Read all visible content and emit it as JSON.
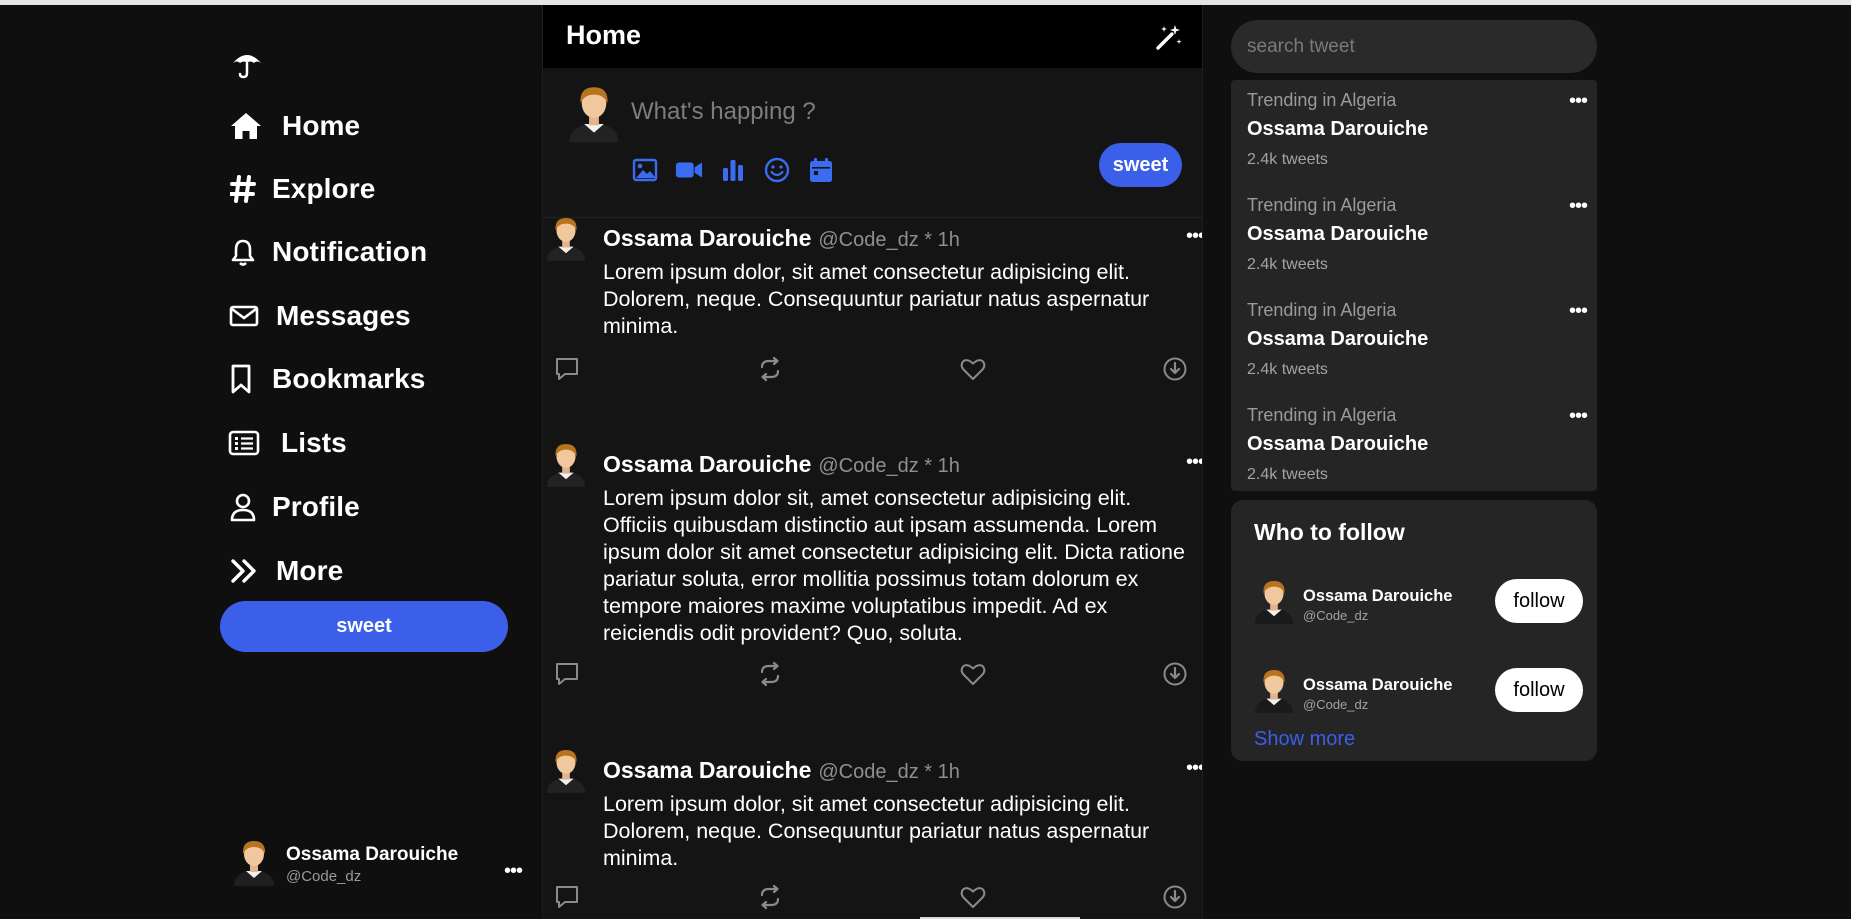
{
  "theme": {
    "accent": "#3b5fe8",
    "background": "#0f0f0f",
    "panel": "#252525",
    "feed": "#141414"
  },
  "sidebar": {
    "logo_icon": "umbrella-icon",
    "items": [
      {
        "label": "Home",
        "icon": "home-icon"
      },
      {
        "label": "Explore",
        "icon": "hash-icon"
      },
      {
        "label": "Notification",
        "icon": "bell-icon"
      },
      {
        "label": "Messages",
        "icon": "envelope-icon"
      },
      {
        "label": "Bookmarks",
        "icon": "bookmark-icon"
      },
      {
        "label": "Lists",
        "icon": "list-icon"
      },
      {
        "label": "Profile",
        "icon": "user-icon"
      },
      {
        "label": "More",
        "icon": "chevrons-right-icon"
      }
    ],
    "sweet_label": "sweet",
    "account": {
      "name": "Ossama Darouiche",
      "handle": "@Code_dz",
      "more": "•••"
    }
  },
  "feed": {
    "title": "Home",
    "header_icon": "magic-wand-icon",
    "composer": {
      "placeholder": "What's happing ?",
      "tools": [
        "image-icon",
        "video-icon",
        "poll-icon",
        "emoji-icon",
        "calendar-icon"
      ],
      "sweet_label": "sweet"
    },
    "tweets": [
      {
        "name": "Ossama Darouiche",
        "meta": "@Code_dz * 1h",
        "more": "•••",
        "text": "Lorem ipsum dolor, sit amet consectetur adipisicing elit. Dolorem, neque. Consequuntur pariatur natus aspernatur minima."
      },
      {
        "name": "Ossama Darouiche",
        "meta": "@Code_dz * 1h",
        "more": "•••",
        "text": "Lorem ipsum dolor sit, amet consectetur adipisicing elit. Officiis quibusdam distinctio aut ipsam assumenda. Lorem ipsum dolor sit amet consectetur adipisicing elit. Dicta ratione pariatur soluta, error mollitia possimus totam dolorum ex tempore maiores maxime voluptatibus impedit. Ad ex reiciendis odit provident? Quo, soluta."
      },
      {
        "name": "Ossama Darouiche",
        "meta": "@Code_dz * 1h",
        "more": "•••",
        "text": "Lorem ipsum dolor, sit amet consectetur adipisicing elit. Dolorem, neque. Consequuntur pariatur natus aspernatur minima."
      }
    ],
    "action_icons": [
      "comment-icon",
      "retweet-icon",
      "heart-icon",
      "download-icon"
    ]
  },
  "right": {
    "search_placeholder": "search tweet",
    "trends": [
      {
        "context": "Trending in Algeria",
        "title": "Ossama Darouiche",
        "count": "2.4k tweets",
        "more": "•••"
      },
      {
        "context": "Trending in Algeria",
        "title": "Ossama Darouiche",
        "count": "2.4k tweets",
        "more": "•••"
      },
      {
        "context": "Trending in Algeria",
        "title": "Ossama Darouiche",
        "count": "2.4k tweets",
        "more": "•••"
      },
      {
        "context": "Trending in Algeria",
        "title": "Ossama Darouiche",
        "count": "2.4k tweets",
        "more": "•••"
      }
    ],
    "who_to_follow": {
      "title": "Who to follow",
      "users": [
        {
          "name": "Ossama Darouiche",
          "handle": "@Code_dz",
          "button": "follow"
        },
        {
          "name": "Ossama Darouiche",
          "handle": "@Code_dz",
          "button": "follow"
        }
      ],
      "show_more": "Show more"
    }
  }
}
